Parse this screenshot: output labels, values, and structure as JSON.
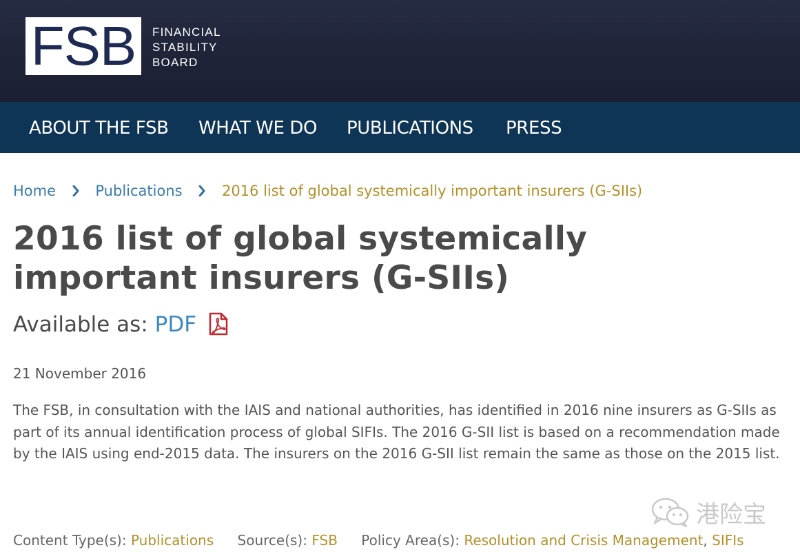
{
  "header": {
    "logo_text": "FSB",
    "logo_subtitle": [
      "FINANCIAL",
      "STABILITY",
      "BOARD"
    ]
  },
  "nav": {
    "items": [
      {
        "label": "ABOUT THE FSB"
      },
      {
        "label": "WHAT WE DO"
      },
      {
        "label": "PUBLICATIONS"
      },
      {
        "label": "PRESS"
      }
    ]
  },
  "breadcrumb": {
    "items": [
      {
        "label": "Home"
      },
      {
        "label": "Publications"
      },
      {
        "label": "2016 list of global systemically important insurers (G-SIIs)"
      }
    ]
  },
  "page": {
    "title": "2016 list of global systemically important insurers (G-SIIs)",
    "available_label": "Available as:",
    "pdf_label": "PDF",
    "pdf_icon": "pdf-file-icon",
    "date": "21 November 2016",
    "body": "The FSB, in consultation with the IAIS and national authorities, has identified in 2016 nine insurers as G-SIIs as part of its annual identification process of global SIFIs. The 2016 G-SII list is based on a recommendation made by the IAIS using end-2015 data. The insurers on the 2016 G-SII list remain the same as those on the 2015 list."
  },
  "meta": {
    "content_type_label": "Content Type(s):",
    "content_type_value": "Publications",
    "source_label": "Source(s):",
    "source_value": "FSB",
    "policy_label": "Policy Area(s):",
    "policy_value_1": "Resolution and Crisis Management",
    "policy_separator": ",",
    "policy_value_2": "SIFIs"
  },
  "watermark": {
    "icon": "wechat-icon",
    "text": "港险宝"
  },
  "colors": {
    "header_bg": "#1e2337",
    "nav_bg": "#0e3556",
    "link_blue": "#3b7cad",
    "gold": "#b3902a",
    "title_gray": "#4a4a4a",
    "pdf_red": "#c0282d"
  }
}
